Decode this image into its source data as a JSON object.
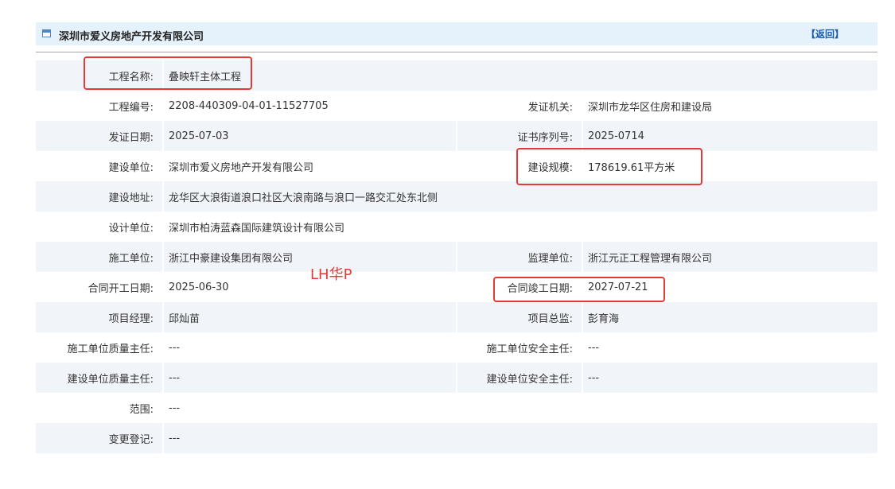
{
  "header": {
    "title": "深圳市爱义房地产开发有限公司",
    "back_label": "【返回】"
  },
  "watermark": "LH华P",
  "rows": [
    {
      "label": "工程名称:",
      "value": "叠映轩主体工程",
      "label2": "",
      "value2": ""
    },
    {
      "label": "工程编号:",
      "value": "2208-440309-04-01-11527705",
      "label2": "发证机关:",
      "value2": "深圳市龙华区住房和建设局"
    },
    {
      "label": "发证日期:",
      "value": "2025-07-03",
      "label2": "证书序列号:",
      "value2": "2025-0714"
    },
    {
      "label": "建设单位:",
      "value": "深圳市爱义房地产开发有限公司",
      "label2": "建设规模:",
      "value2": "178619.61平方米"
    },
    {
      "label": "建设地址:",
      "value": "龙华区大浪街道浪口社区大浪南路与浪口一路交汇处东北侧",
      "label2": "",
      "value2": ""
    },
    {
      "label": "设计单位:",
      "value": "深圳市柏涛蓝森国际建筑设计有限公司",
      "label2": "",
      "value2": ""
    },
    {
      "label": "施工单位:",
      "value": "浙江中豪建设集团有限公司",
      "label2": "监理单位:",
      "value2": "浙江元正工程管理有限公司"
    },
    {
      "label": "合同开工日期:",
      "value": "2025-06-30",
      "label2": "合同竣工日期:",
      "value2": "2027-07-21"
    },
    {
      "label": "项目经理:",
      "value": "邱灿苗",
      "label2": "项目总监:",
      "value2": "彭育海"
    },
    {
      "label": "施工单位质量主任:",
      "value": "---",
      "label2": "施工单位安全主任:",
      "value2": "---"
    },
    {
      "label": "建设单位质量主任:",
      "value": "---",
      "label2": "建设单位安全主任:",
      "value2": "---"
    },
    {
      "label": "范围:",
      "value": "---",
      "label2": "",
      "value2": ""
    },
    {
      "label": "变更登记:",
      "value": "---",
      "label2": "",
      "value2": ""
    }
  ]
}
